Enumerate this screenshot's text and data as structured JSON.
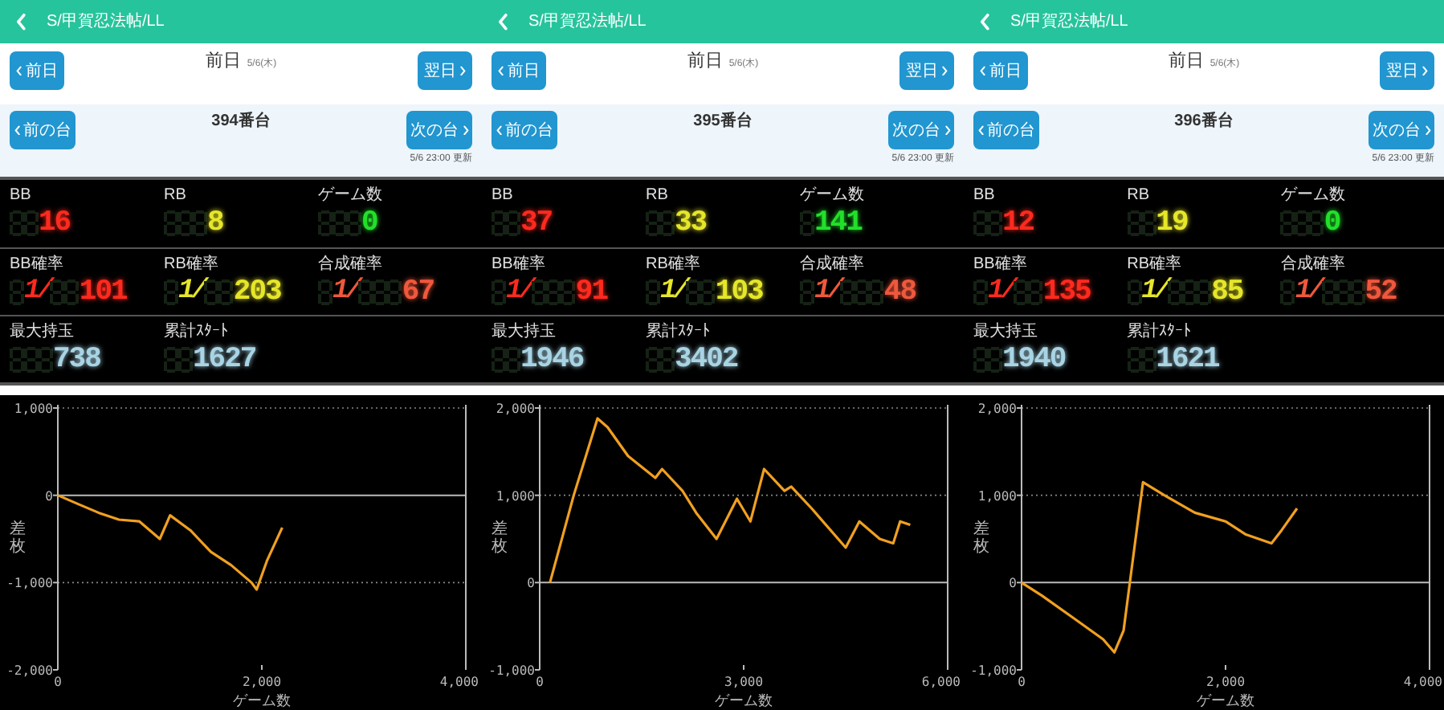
{
  "panels": [
    {
      "header": {
        "title": "S/甲賀忍法帖/LL"
      },
      "day_nav": {
        "prev_button": "前日",
        "title": "前日",
        "date": "5/6(木)",
        "next_button": "翌日"
      },
      "machine_nav": {
        "prev_button": "前の台",
        "title": "394番台",
        "next_button": "次の台",
        "updated": "5/6 23:00 更新"
      },
      "stats": [
        [
          {
            "label": "BB",
            "kind": "count",
            "value": "16",
            "color": "#ff2a1e"
          },
          {
            "label": "RB",
            "kind": "count",
            "value": "8",
            "color": "#e6e62a"
          },
          {
            "label": "ゲーム数",
            "kind": "count",
            "value": "0",
            "color": "#22e02a"
          }
        ],
        [
          {
            "label": "BB確率",
            "kind": "ratio",
            "prefix": "1/",
            "value": "101",
            "color": "#ff2a1e"
          },
          {
            "label": "RB確率",
            "kind": "ratio",
            "prefix": "1/",
            "value": "203",
            "color": "#e6e62a"
          },
          {
            "label": "合成確率",
            "kind": "ratio",
            "prefix": "1/",
            "value": "67",
            "color": "#f0583c"
          }
        ],
        [
          {
            "label": "最大持玉",
            "kind": "balls",
            "value": "738",
            "color": "#a8d4e4"
          },
          {
            "label": "累計ｽﾀｰﾄ",
            "kind": "balls",
            "value": "1627",
            "color": "#a8d4e4"
          }
        ]
      ],
      "chart_data": {
        "type": "line",
        "xlabel": "ゲーム数",
        "ylabel": "差枚",
        "xlim": [
          0,
          4000
        ],
        "ylim": [
          -2000,
          1000
        ],
        "xticks": [
          {
            "value": 0,
            "label": "0"
          },
          {
            "value": 2000,
            "label": "2,000"
          },
          {
            "value": 4000,
            "label": "4,000"
          }
        ],
        "yticks": [
          {
            "value": -2000,
            "label": "-2,000"
          },
          {
            "value": -1000,
            "label": "-1,000"
          },
          {
            "value": 0,
            "label": "0"
          },
          {
            "value": 1000,
            "label": "1,000"
          }
        ],
        "ref_lines": [
          {
            "axis": "y",
            "value": -1000
          },
          {
            "axis": "y",
            "value": 1000
          }
        ],
        "x": [
          0,
          200,
          400,
          600,
          800,
          1000,
          1100,
          1300,
          1500,
          1700,
          1900,
          1950,
          2050,
          2200
        ],
        "series": [
          {
            "color": "#f0a020",
            "values": [
              0,
              -100,
              -200,
              -280,
              -300,
              -500,
              -230,
              -400,
              -650,
              -800,
              -1000,
              -1080,
              -750,
              -370
            ]
          }
        ]
      }
    },
    {
      "header": {
        "title": "S/甲賀忍法帖/LL"
      },
      "day_nav": {
        "prev_button": "前日",
        "title": "前日",
        "date": "5/6(木)",
        "next_button": "翌日"
      },
      "machine_nav": {
        "prev_button": "前の台",
        "title": "395番台",
        "next_button": "次の台",
        "updated": "5/6 23:00 更新"
      },
      "stats": [
        [
          {
            "label": "BB",
            "kind": "count",
            "value": "37",
            "color": "#ff2a1e"
          },
          {
            "label": "RB",
            "kind": "count",
            "value": "33",
            "color": "#e6e62a"
          },
          {
            "label": "ゲーム数",
            "kind": "count",
            "value": "141",
            "color": "#22e02a"
          }
        ],
        [
          {
            "label": "BB確率",
            "kind": "ratio",
            "prefix": "1/",
            "value": "91",
            "color": "#ff2a1e"
          },
          {
            "label": "RB確率",
            "kind": "ratio",
            "prefix": "1/",
            "value": "103",
            "color": "#e6e62a"
          },
          {
            "label": "合成確率",
            "kind": "ratio",
            "prefix": "1/",
            "value": "48",
            "color": "#f0583c"
          }
        ],
        [
          {
            "label": "最大持玉",
            "kind": "balls",
            "value": "1946",
            "color": "#a8d4e4"
          },
          {
            "label": "累計ｽﾀｰﾄ",
            "kind": "balls",
            "value": "3402",
            "color": "#a8d4e4"
          }
        ]
      ],
      "chart_data": {
        "type": "line",
        "xlabel": "ゲーム数",
        "ylabel": "差枚",
        "xlim": [
          0,
          6000
        ],
        "ylim": [
          -1000,
          2000
        ],
        "xticks": [
          {
            "value": 0,
            "label": "0"
          },
          {
            "value": 3000,
            "label": "3,000"
          },
          {
            "value": 6000,
            "label": "6,000"
          }
        ],
        "yticks": [
          {
            "value": -1000,
            "label": "-1,000"
          },
          {
            "value": 0,
            "label": "0"
          },
          {
            "value": 1000,
            "label": "1,000"
          },
          {
            "value": 2000,
            "label": "2,000"
          }
        ],
        "ref_lines": [
          {
            "axis": "y",
            "value": 1000
          },
          {
            "axis": "y",
            "value": 2000
          }
        ],
        "x": [
          150,
          500,
          850,
          1000,
          1300,
          1700,
          1800,
          2100,
          2300,
          2600,
          2900,
          3100,
          3300,
          3600,
          3700,
          4000,
          4500,
          4700,
          5000,
          5200,
          5300,
          5450
        ],
        "series": [
          {
            "color": "#f0a020",
            "values": [
              0,
              1000,
              1880,
              1780,
              1450,
              1200,
              1300,
              1050,
              800,
              500,
              960,
              700,
              1300,
              1050,
              1100,
              850,
              400,
              700,
              500,
              450,
              700,
              660
            ]
          }
        ]
      }
    },
    {
      "header": {
        "title": "S/甲賀忍法帖/LL"
      },
      "day_nav": {
        "prev_button": "前日",
        "title": "前日",
        "date": "5/6(木)",
        "next_button": "翌日"
      },
      "machine_nav": {
        "prev_button": "前の台",
        "title": "396番台",
        "next_button": "次の台",
        "updated": "5/6 23:00 更新"
      },
      "stats": [
        [
          {
            "label": "BB",
            "kind": "count",
            "value": "12",
            "color": "#ff2a1e"
          },
          {
            "label": "RB",
            "kind": "count",
            "value": "19",
            "color": "#e6e62a"
          },
          {
            "label": "ゲーム数",
            "kind": "count",
            "value": "0",
            "color": "#22e02a"
          }
        ],
        [
          {
            "label": "BB確率",
            "kind": "ratio",
            "prefix": "1/",
            "value": "135",
            "color": "#ff2a1e"
          },
          {
            "label": "RB確率",
            "kind": "ratio",
            "prefix": "1/",
            "value": "85",
            "color": "#e6e62a"
          },
          {
            "label": "合成確率",
            "kind": "ratio",
            "prefix": "1/",
            "value": "52",
            "color": "#f0583c"
          }
        ],
        [
          {
            "label": "最大持玉",
            "kind": "balls",
            "value": "1940",
            "color": "#a8d4e4"
          },
          {
            "label": "累計ｽﾀｰﾄ",
            "kind": "balls",
            "value": "1621",
            "color": "#a8d4e4"
          }
        ]
      ],
      "chart_data": {
        "type": "line",
        "xlabel": "ゲーム数",
        "ylabel": "差枚",
        "xlim": [
          0,
          4000
        ],
        "ylim": [
          -1000,
          2000
        ],
        "xticks": [
          {
            "value": 0,
            "label": "0"
          },
          {
            "value": 2000,
            "label": "2,000"
          },
          {
            "value": 4000,
            "label": "4,000"
          }
        ],
        "yticks": [
          {
            "value": -1000,
            "label": "-1,000"
          },
          {
            "value": 0,
            "label": "0"
          },
          {
            "value": 1000,
            "label": "1,000"
          },
          {
            "value": 2000,
            "label": "2,000"
          }
        ],
        "ref_lines": [
          {
            "axis": "y",
            "value": 1000
          },
          {
            "axis": "y",
            "value": 2000
          }
        ],
        "x": [
          0,
          200,
          500,
          800,
          910,
          1000,
          1190,
          1400,
          1700,
          2000,
          2200,
          2450,
          2550,
          2700
        ],
        "series": [
          {
            "color": "#f0a020",
            "values": [
              0,
              -150,
              -400,
              -650,
              -800,
              -550,
              1150,
              1000,
              800,
              700,
              550,
              450,
              600,
              850
            ]
          }
        ]
      }
    }
  ]
}
